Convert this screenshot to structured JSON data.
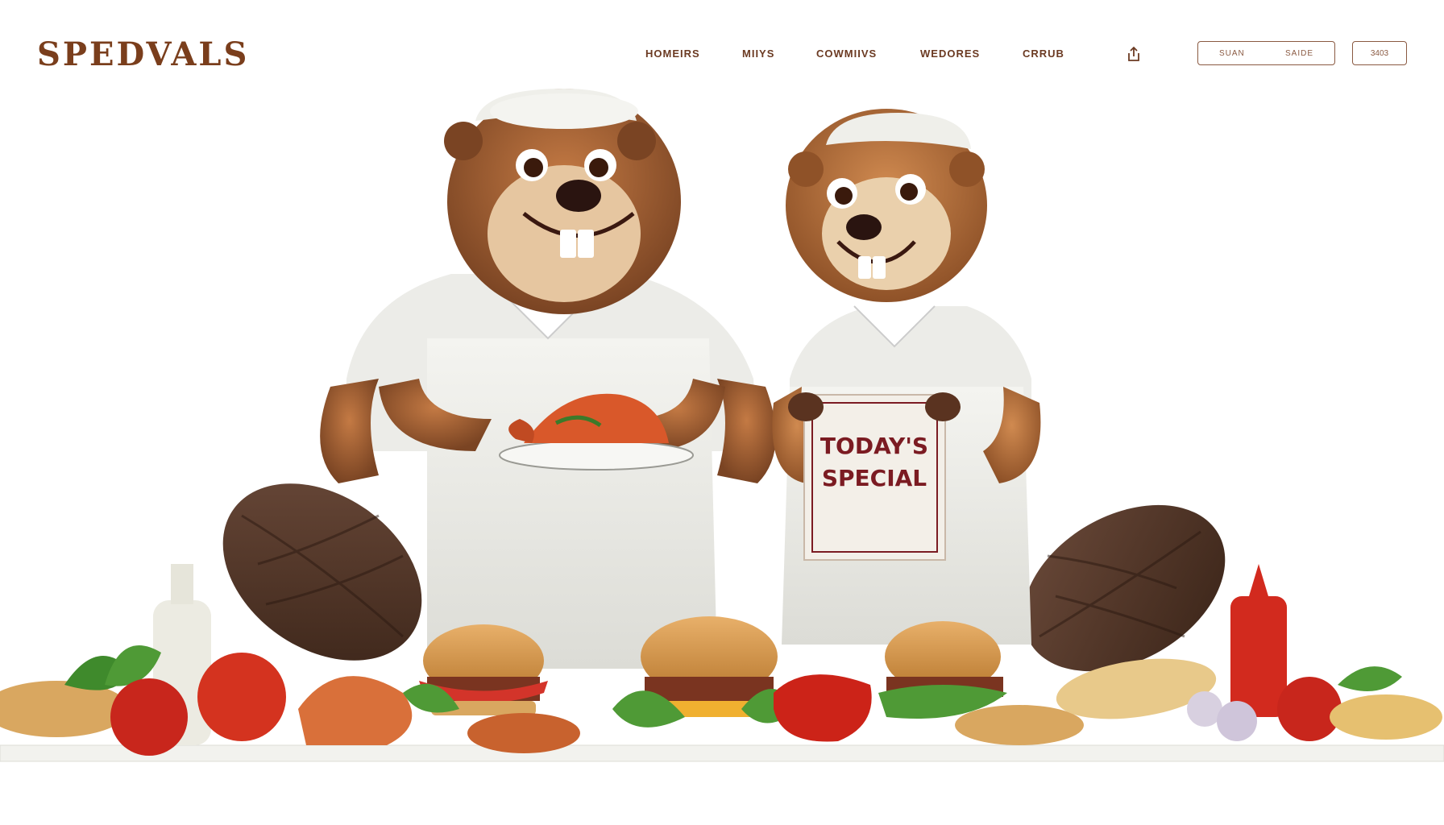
{
  "brand": {
    "logo_text": "SPEDVALS",
    "accent": "#7a3e1c"
  },
  "nav": {
    "items": [
      {
        "label": "HOMEIRS"
      },
      {
        "label": "MIIYS"
      },
      {
        "label": "COWMIIVS"
      },
      {
        "label": "WEDORES"
      },
      {
        "label": "CRRUB"
      }
    ]
  },
  "toolbar": {
    "share_icon": "share-icon",
    "search_left": "SUAN",
    "search_right": "SAIDE",
    "count": "3403"
  },
  "hero": {
    "sign_line1": "TODAY'S",
    "sign_line2": "SPECIAL",
    "sign_color": "#7b1b22"
  }
}
